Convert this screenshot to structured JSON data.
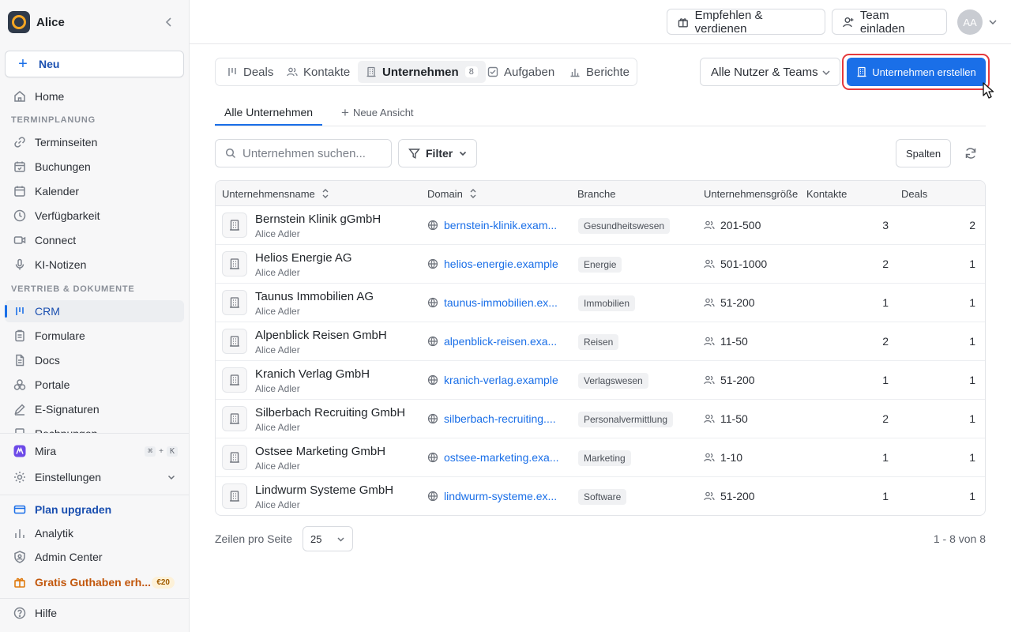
{
  "workspace": {
    "name": "Alice"
  },
  "sidebar": {
    "new_label": "Neu",
    "home": "Home",
    "section_scheduling": "TERMINPLANUNG",
    "scheduling_items": [
      "Terminseiten",
      "Buchungen",
      "Kalender",
      "Verfügbarkeit",
      "Connect",
      "KI-Notizen"
    ],
    "section_sales": "VERTRIEB & DOKUMENTE",
    "sales_items": [
      "CRM",
      "Formulare",
      "Docs",
      "Portale",
      "E-Signaturen",
      "Rechnungen"
    ],
    "active_item": "CRM",
    "mira": "Mira",
    "mira_shortcut": [
      "⌘",
      "+",
      "K"
    ],
    "settings": "Einstellungen",
    "plan_upgrade": "Plan upgraden",
    "analytics": "Analytik",
    "admin_center": "Admin Center",
    "gift": "Gratis Guthaben erh...",
    "gift_badge": "€20",
    "help": "Hilfe"
  },
  "topbar": {
    "refer_label": "Empfehlen & verdienen",
    "invite_label": "Team einladen",
    "avatar_initials": "AA"
  },
  "tabs": [
    {
      "label": "Deals",
      "icon": "pipeline-icon"
    },
    {
      "label": "Kontakte",
      "icon": "users-icon"
    },
    {
      "label": "Unternehmen",
      "icon": "building-icon",
      "count": "8",
      "active": true
    },
    {
      "label": "Aufgaben",
      "icon": "check-square-icon"
    },
    {
      "label": "Berichte",
      "icon": "bar-chart-icon"
    }
  ],
  "user_filter": "Alle Nutzer & Teams",
  "create_button": "Unternehmen erstellen",
  "views": {
    "active": "Alle Unternehmen",
    "add": "Neue Ansicht"
  },
  "toolbar": {
    "search_placeholder": "Unternehmen suchen...",
    "filter_label": "Filter",
    "columns_label": "Spalten"
  },
  "table": {
    "headers": {
      "name": "Unternehmensname",
      "domain": "Domain",
      "industry": "Branche",
      "size": "Unternehmensgröße",
      "contacts": "Kontakte",
      "deals": "Deals"
    },
    "rows": [
      {
        "name": "Bernstein Klinik gGmbH",
        "owner": "Alice Adler",
        "domain": "bernstein-klinik.exam...",
        "industry": "Gesundheitswesen",
        "size": "201-500",
        "contacts": "3",
        "deals": "2"
      },
      {
        "name": "Helios Energie AG",
        "owner": "Alice Adler",
        "domain": "helios-energie.example",
        "industry": "Energie",
        "size": "501-1000",
        "contacts": "2",
        "deals": "1"
      },
      {
        "name": "Taunus Immobilien AG",
        "owner": "Alice Adler",
        "domain": "taunus-immobilien.ex...",
        "industry": "Immobilien",
        "size": "51-200",
        "contacts": "1",
        "deals": "1"
      },
      {
        "name": "Alpenblick Reisen GmbH",
        "owner": "Alice Adler",
        "domain": "alpenblick-reisen.exa...",
        "industry": "Reisen",
        "size": "11-50",
        "contacts": "2",
        "deals": "1"
      },
      {
        "name": "Kranich Verlag GmbH",
        "owner": "Alice Adler",
        "domain": "kranich-verlag.example",
        "industry": "Verlagswesen",
        "size": "51-200",
        "contacts": "1",
        "deals": "1"
      },
      {
        "name": "Silberbach Recruiting GmbH",
        "owner": "Alice Adler",
        "domain": "silberbach-recruiting....",
        "industry": "Personalvermittlung",
        "size": "11-50",
        "contacts": "2",
        "deals": "1"
      },
      {
        "name": "Ostsee Marketing GmbH",
        "owner": "Alice Adler",
        "domain": "ostsee-marketing.exa...",
        "industry": "Marketing",
        "size": "1-10",
        "contacts": "1",
        "deals": "1"
      },
      {
        "name": "Lindwurm Systeme GmbH",
        "owner": "Alice Adler",
        "domain": "lindwurm-systeme.ex...",
        "industry": "Software",
        "size": "51-200",
        "contacts": "1",
        "deals": "1"
      }
    ]
  },
  "pagination": {
    "rows_per_page_label": "Zeilen pro Seite",
    "rows_per_page": "25",
    "range": "1 - 8 von 8"
  },
  "colors": {
    "accent": "#1a6fe8",
    "highlight_outline": "#e5393c",
    "gift": "#c2570c"
  }
}
